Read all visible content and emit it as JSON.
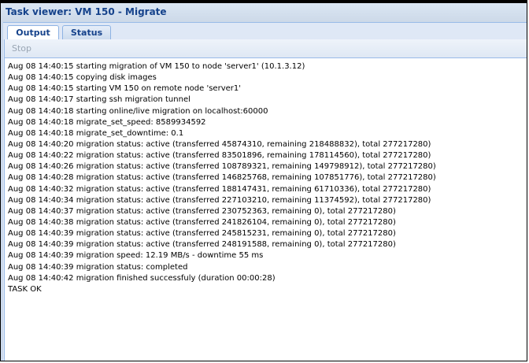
{
  "window": {
    "title": "Task viewer: VM 150 - Migrate"
  },
  "tabs": [
    {
      "label": "Output",
      "active": true
    },
    {
      "label": "Status",
      "active": false
    }
  ],
  "toolbar": {
    "stop_label": "Stop",
    "stop_enabled": false
  },
  "log": {
    "lines": [
      "Aug 08 14:40:15 starting migration of VM 150 to node 'server1' (10.1.3.12)",
      "Aug 08 14:40:15 copying disk images",
      "Aug 08 14:40:15 starting VM 150 on remote node 'server1'",
      "Aug 08 14:40:17 starting ssh migration tunnel",
      "Aug 08 14:40:18 starting online/live migration on localhost:60000",
      "Aug 08 14:40:18 migrate_set_speed: 8589934592",
      "Aug 08 14:40:18 migrate_set_downtime: 0.1",
      "Aug 08 14:40:20 migration status: active (transferred 45874310, remaining 218488832), total 277217280)",
      "Aug 08 14:40:22 migration status: active (transferred 83501896, remaining 178114560), total 277217280)",
      "Aug 08 14:40:26 migration status: active (transferred 108789321, remaining 149798912), total 277217280)",
      "Aug 08 14:40:28 migration status: active (transferred 146825768, remaining 107851776), total 277217280)",
      "Aug 08 14:40:32 migration status: active (transferred 188147431, remaining 61710336), total 277217280)",
      "Aug 08 14:40:34 migration status: active (transferred 227103210, remaining 11374592), total 277217280)",
      "Aug 08 14:40:37 migration status: active (transferred 230752363, remaining 0), total 277217280)",
      "Aug 08 14:40:38 migration status: active (transferred 241826104, remaining 0), total 277217280)",
      "Aug 08 14:40:39 migration status: active (transferred 245815231, remaining 0), total 277217280)",
      "Aug 08 14:40:39 migration status: active (transferred 248191588, remaining 0), total 277217280)",
      "Aug 08 14:40:39 migration speed: 12.19 MB/s - downtime 55 ms",
      "Aug 08 14:40:39 migration status: completed",
      "Aug 08 14:40:42 migration finished successfuly (duration 00:00:28)",
      "TASK OK"
    ]
  }
}
